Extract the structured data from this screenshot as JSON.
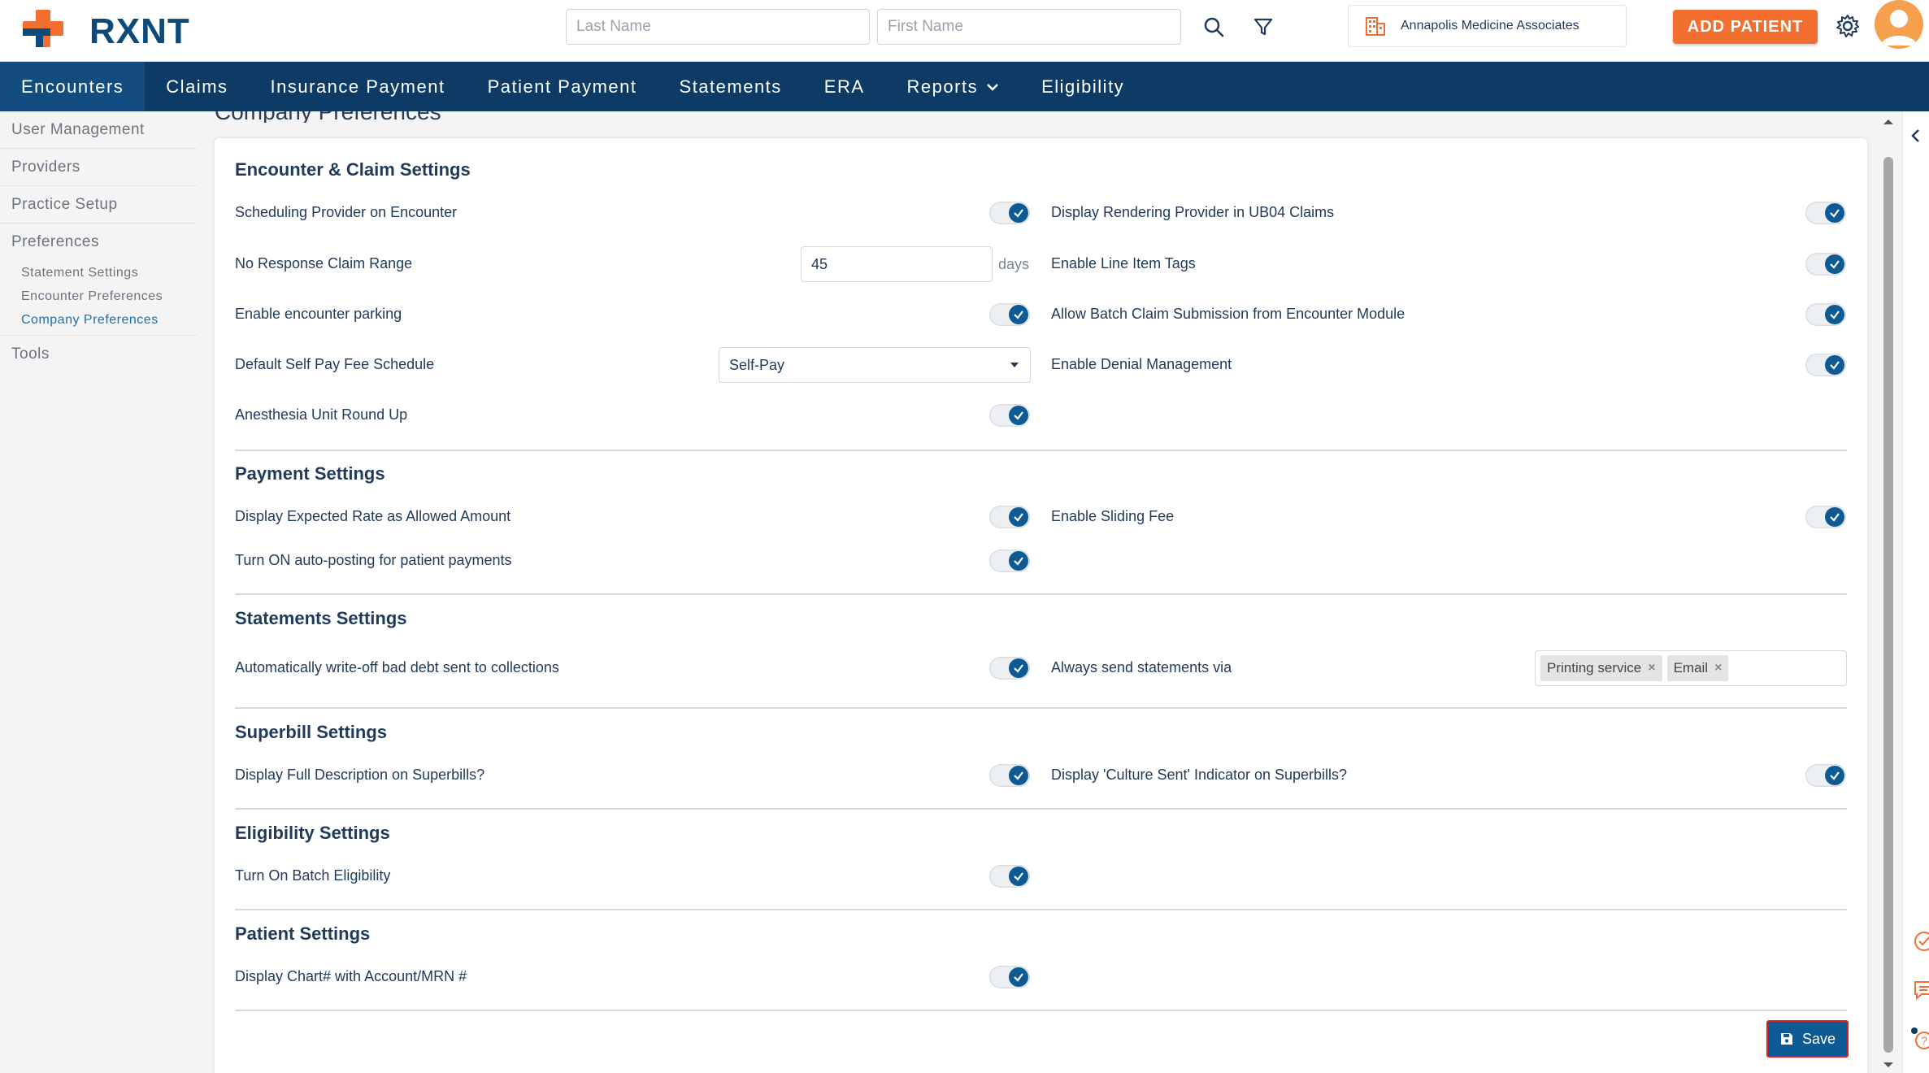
{
  "header": {
    "brand": "RXNT",
    "last_name_placeholder": "Last Name",
    "first_name_placeholder": "First Name",
    "practice_name": "Annapolis Medicine Associates",
    "add_patient_label": "ADD PATIENT"
  },
  "nav": {
    "items": [
      {
        "label": "Encounters"
      },
      {
        "label": "Claims"
      },
      {
        "label": "Insurance Payment"
      },
      {
        "label": "Patient Payment"
      },
      {
        "label": "Statements"
      },
      {
        "label": "ERA"
      },
      {
        "label": "Reports"
      },
      {
        "label": "Eligibility"
      }
    ]
  },
  "sidebar": {
    "items": [
      {
        "label": "User Management"
      },
      {
        "label": "Providers"
      },
      {
        "label": "Practice Setup"
      },
      {
        "label": "Preferences"
      }
    ],
    "sub_items": [
      {
        "label": "Statement Settings"
      },
      {
        "label": "Encounter Preferences"
      },
      {
        "label": "Company Preferences"
      }
    ],
    "tools_label": "Tools"
  },
  "page": {
    "title": "Company Preferences"
  },
  "sections": {
    "encounter": {
      "title": "Encounter & Claim Settings",
      "scheduling_provider": "Scheduling Provider on Encounter",
      "no_response_range": "No Response Claim Range",
      "no_response_value": "45",
      "no_response_unit": "days",
      "encounter_parking": "Enable encounter parking",
      "default_fee_schedule": "Default Self Pay Fee Schedule",
      "default_fee_schedule_value": "Self-Pay",
      "anesthesia_round_up": "Anesthesia Unit Round Up",
      "rendering_provider_ub04": "Display Rendering Provider in UB04 Claims",
      "line_item_tags": "Enable Line Item Tags",
      "batch_claim_submission": "Allow Batch Claim Submission from Encounter Module",
      "denial_management": "Enable Denial Management"
    },
    "payment": {
      "title": "Payment Settings",
      "expected_rate": "Display Expected Rate as Allowed Amount",
      "auto_posting": "Turn ON auto-posting for patient payments",
      "sliding_fee": "Enable Sliding Fee"
    },
    "statements": {
      "title": "Statements Settings",
      "write_off": "Automatically write-off bad debt sent to collections",
      "send_via": "Always send statements via",
      "send_via_tags": [
        "Printing service",
        "Email"
      ]
    },
    "superbill": {
      "title": "Superbill Settings",
      "full_description": "Display Full Description on Superbills?",
      "culture_sent": "Display 'Culture Sent' Indicator on Superbills?"
    },
    "eligibility": {
      "title": "Eligibility Settings",
      "batch_eligibility": "Turn On Batch Eligibility"
    },
    "patient": {
      "title": "Patient Settings",
      "chart_with_mrn": "Display Chart# with Account/MRN #"
    }
  },
  "actions": {
    "save_label": "Save"
  },
  "colors": {
    "nav_bg": "#0d3b66",
    "accent_orange": "#f26f2f",
    "toggle_on": "#0d5a94"
  }
}
